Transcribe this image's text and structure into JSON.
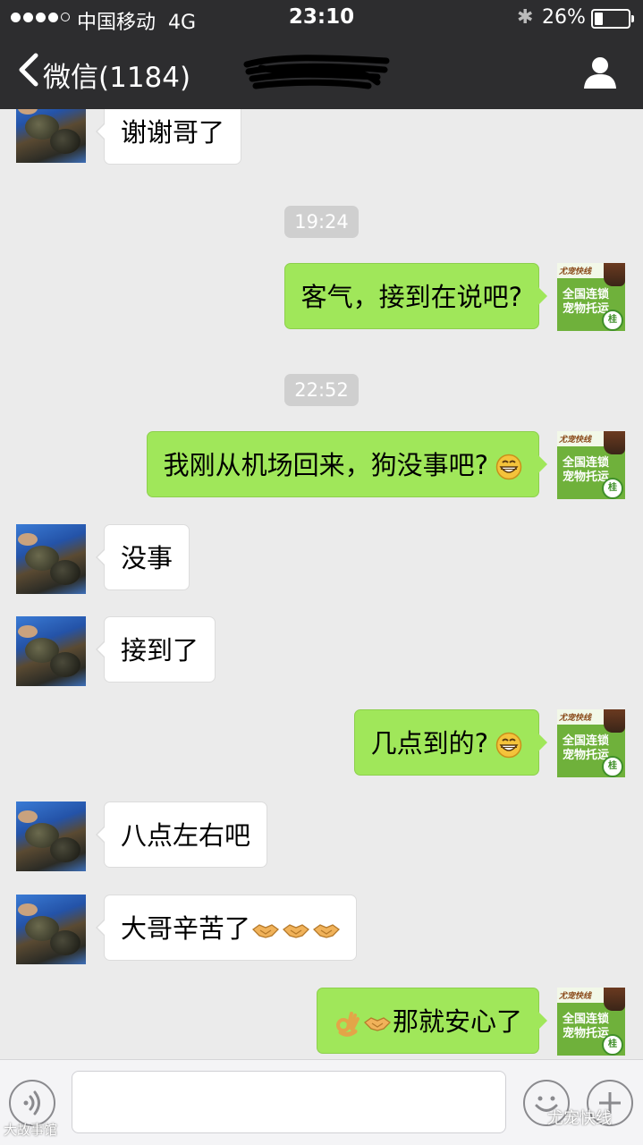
{
  "status_bar": {
    "carrier": "中国移动",
    "network": "4G",
    "time": "23:10",
    "battery": "26%",
    "battery_level": 0.26
  },
  "nav": {
    "back_label": "微信(1184)",
    "title_redacted": true
  },
  "messages": [
    {
      "side": "in",
      "text": "谢谢哥了"
    },
    {
      "type": "time",
      "text": "19:24"
    },
    {
      "side": "out",
      "text": "客气，接到在说吧?"
    },
    {
      "type": "time",
      "text": "22:52"
    },
    {
      "side": "out",
      "text": "我刚从机场回来，狗没事吧?",
      "emoji": "grin-emoji"
    },
    {
      "side": "in",
      "text": "没事"
    },
    {
      "side": "in",
      "text": "接到了"
    },
    {
      "side": "out",
      "text": "几点到的?",
      "emoji": "grin-emoji"
    },
    {
      "side": "in",
      "text": "八点左右吧"
    },
    {
      "side": "in",
      "text": "大哥辛苦了",
      "emoji": "handshake-emoji x3"
    },
    {
      "side": "out",
      "text": "那就安心了",
      "emoji_before": "ok-hand-emoji, handshake-emoji"
    }
  ],
  "my_avatar": {
    "brand": "尤宠快线",
    "line1": "全国连锁",
    "line2": "宠物托运",
    "badge": "桂"
  },
  "input_bar": {
    "voice_icon": "voice-icon",
    "emoji_icon": "emoji-face-icon",
    "plus_icon": "plus-icon"
  },
  "watermarks": {
    "left": "大故事馆",
    "right": "尤宠快线"
  }
}
